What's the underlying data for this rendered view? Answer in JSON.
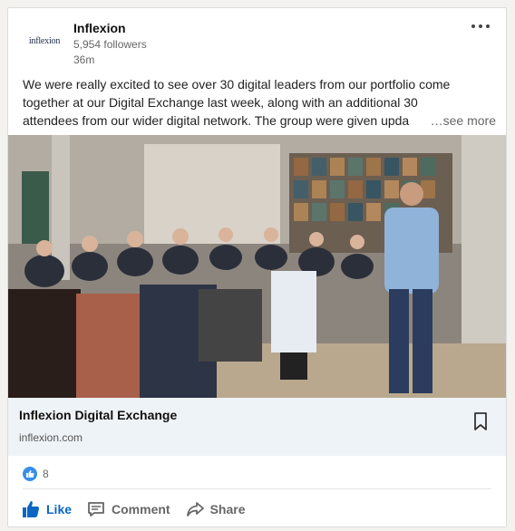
{
  "post": {
    "company": "Inflexion",
    "logo_text": "inflexion",
    "followers": "5,954 followers",
    "time": "36m",
    "text_lines": [
      "We were really excited to see over 30 digital leaders from our portfolio come",
      "together at our Digital Exchange last week, along with an additional 30",
      "attendees from our wider digital network. The group were given upda"
    ],
    "see_more": "…see more"
  },
  "link": {
    "title": "Inflexion Digital Exchange",
    "domain": "inflexion.com"
  },
  "social": {
    "reaction_count": "8"
  },
  "actions": {
    "like": "Like",
    "comment": "Comment",
    "share": "Share"
  },
  "icons": {
    "more": "more-icon",
    "bookmark": "bookmark-icon",
    "reaction": "thumbs-up-icon",
    "like": "thumbs-up-icon",
    "comment": "comment-icon",
    "share": "share-icon"
  },
  "colors": {
    "accent": "#0a66c2",
    "reaction": "#378fe9",
    "link_bg": "#eef3f8"
  }
}
